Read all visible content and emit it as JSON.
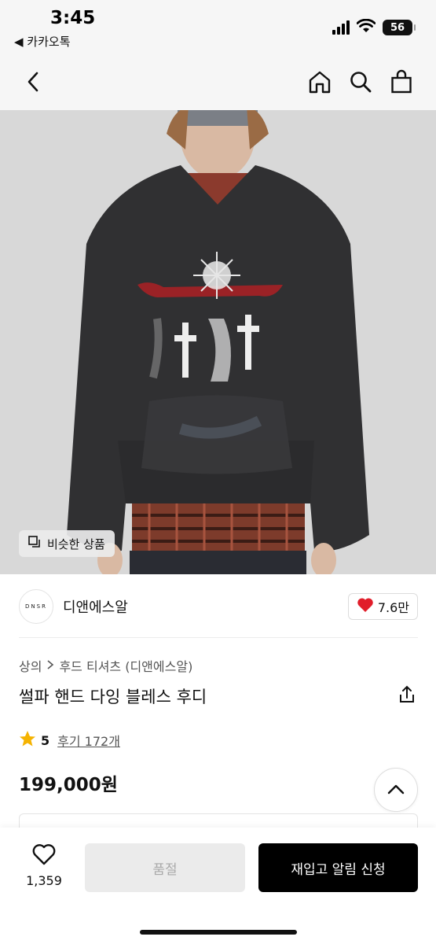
{
  "status_bar": {
    "time": "3:45",
    "back_app": "◀ 카카오톡",
    "battery": "56"
  },
  "nav": {
    "icons": [
      "chevron-left-icon",
      "home-icon",
      "search-icon",
      "shopping-bag-icon"
    ]
  },
  "image": {
    "similar_label": "비슷한 상품"
  },
  "brand": {
    "logo_text": "DNSR",
    "name": "디앤에스알",
    "likes": "7.6만"
  },
  "breadcrumb": {
    "category": "상의",
    "subcategory": "후드 티셔츠 (디앤에스알)"
  },
  "product": {
    "title": "썰파 핸드 다잉 블레스 후디",
    "rating": "5",
    "review_label": "후기 172개",
    "price": "199,000원"
  },
  "bottom": {
    "wish_count": "1,359",
    "soldout_label": "품절",
    "restock_label": "재입고 알림 신청"
  },
  "colors": {
    "accent": "#000000",
    "heart": "#e11d2a",
    "star": "#f5b301"
  }
}
